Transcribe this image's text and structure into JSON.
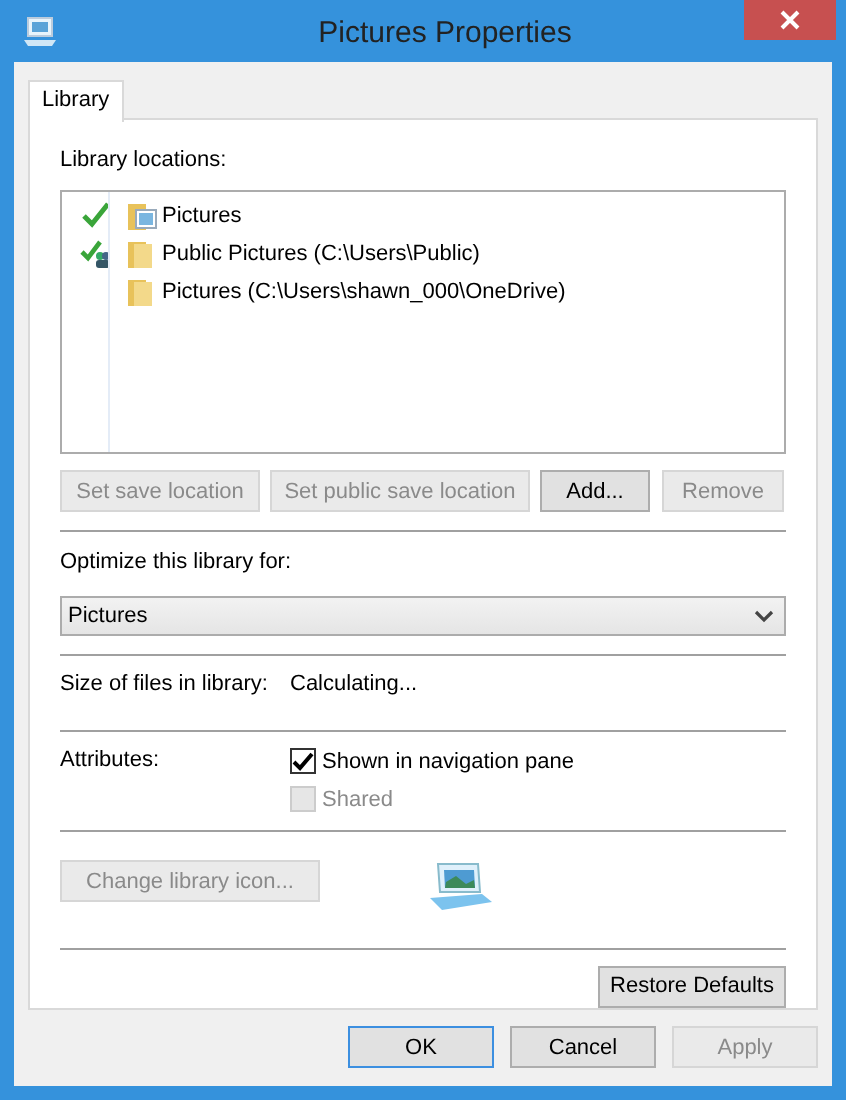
{
  "window": {
    "title": "Pictures Properties"
  },
  "tabs": [
    {
      "label": "Library",
      "selected": true
    }
  ],
  "library_locations": {
    "label": "Library locations:",
    "items": [
      {
        "name": "Pictures",
        "save_location": true,
        "public_save_location": false,
        "picture_folder": true,
        "selected": false
      },
      {
        "name": "Public Pictures (C:\\Users\\Public)",
        "save_location": false,
        "public_save_location": true,
        "picture_folder": false,
        "selected": false
      },
      {
        "name": "Pictures (C:\\Users\\shawn_000\\OneDrive)",
        "save_location": false,
        "public_save_location": false,
        "picture_folder": false,
        "selected": false
      }
    ]
  },
  "location_buttons": [
    {
      "label": "Set save location",
      "disabled": true
    },
    {
      "label": "Set public save location",
      "disabled": true
    },
    {
      "label": "Add...",
      "disabled": false
    },
    {
      "label": "Remove",
      "disabled": true
    }
  ],
  "optimize": {
    "label": "Optimize this library for:",
    "value": "Pictures"
  },
  "size": {
    "label": "Size of files in library:",
    "value": "Calculating..."
  },
  "attributes": {
    "label": "Attributes:",
    "options": [
      {
        "label": "Shown in navigation pane",
        "checked": true,
        "disabled": false
      },
      {
        "label": "Shared",
        "checked": false,
        "disabled": true
      }
    ]
  },
  "change_icon_button": {
    "label": "Change library icon...",
    "disabled": true
  },
  "restore_button": {
    "label": "Restore Defaults",
    "disabled": false
  },
  "dialog_buttons": [
    {
      "label": "OK",
      "default": true,
      "disabled": false
    },
    {
      "label": "Cancel",
      "default": false,
      "disabled": false
    },
    {
      "label": "Apply",
      "default": false,
      "disabled": true
    }
  ]
}
